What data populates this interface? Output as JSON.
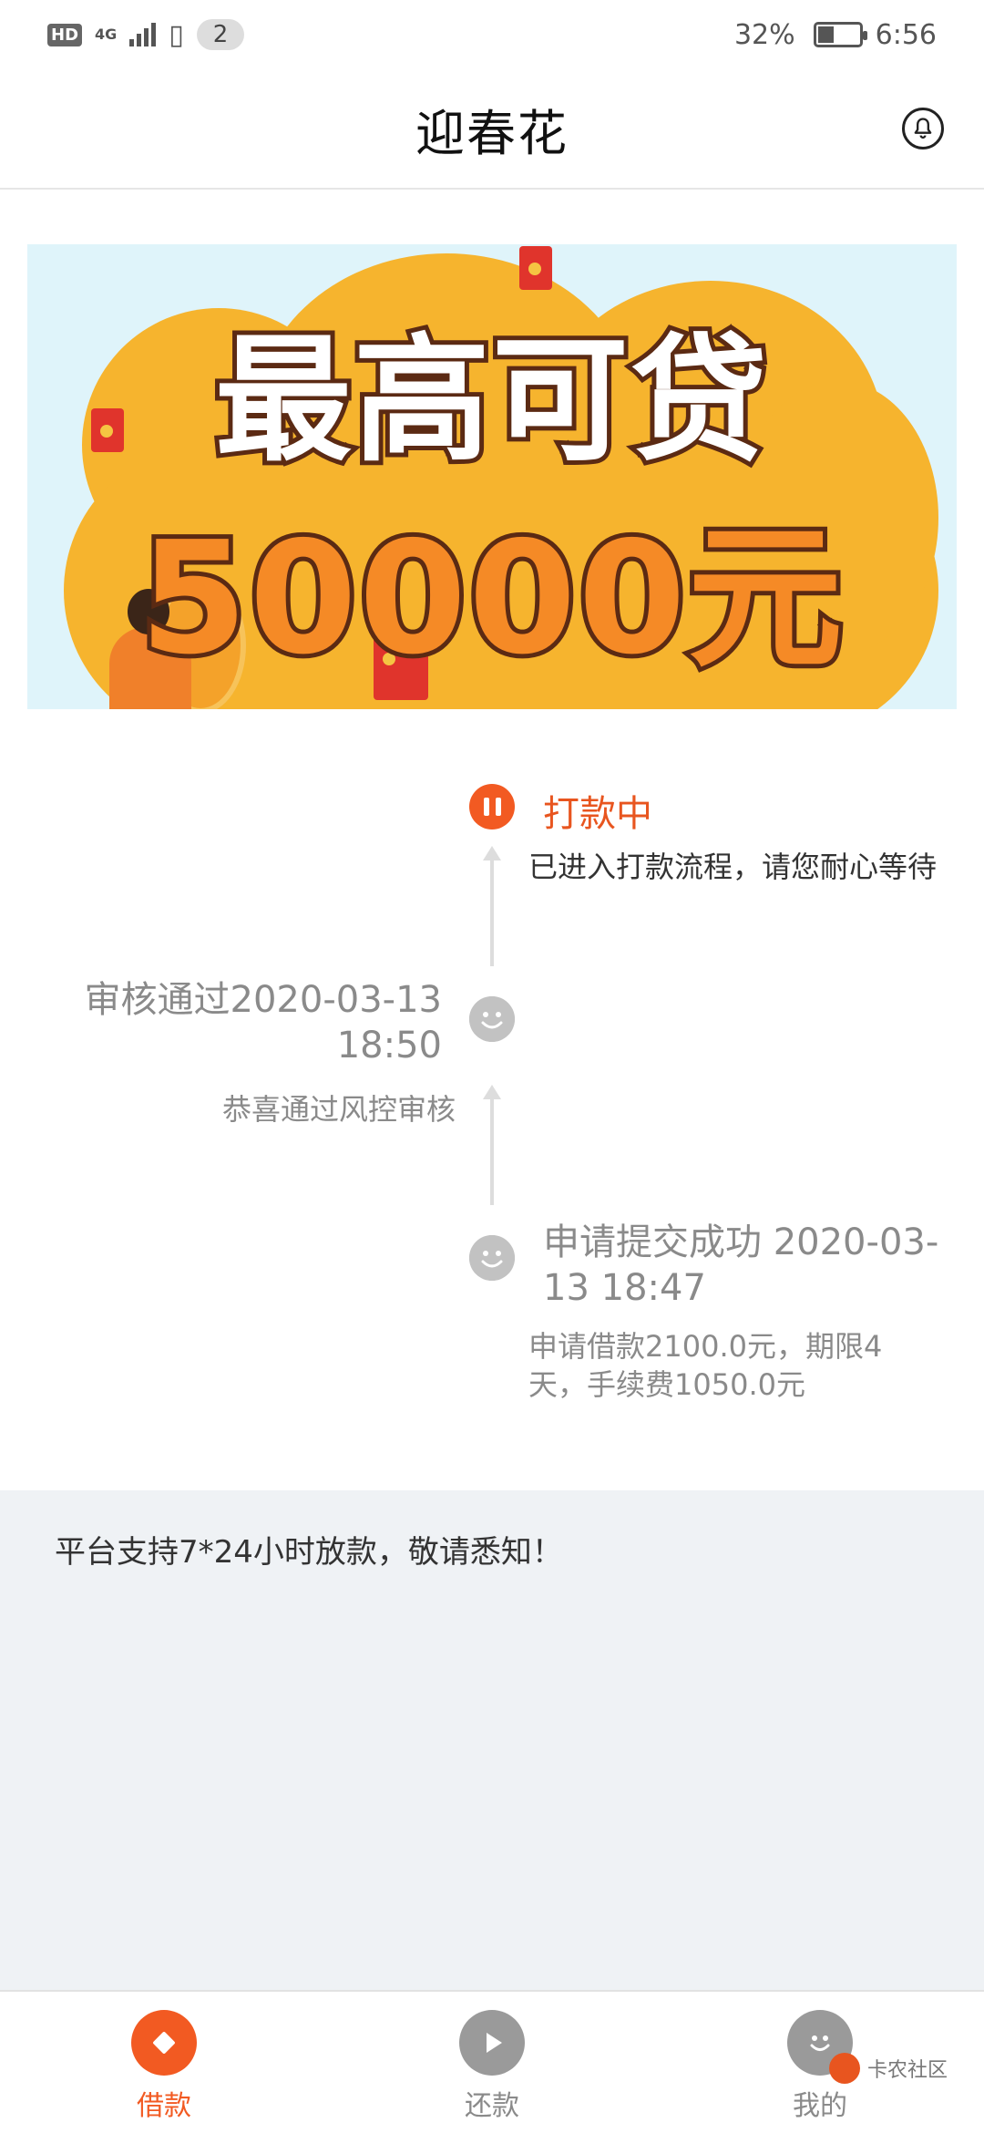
{
  "status_bar": {
    "hd": "HD",
    "network": "4G",
    "notification_count": "2",
    "battery_percent": "32%",
    "time": "6:56"
  },
  "header": {
    "title": "迎春花",
    "bell_icon": "bell-icon"
  },
  "banner": {
    "line1": "最高可贷",
    "line2": "50000元"
  },
  "timeline": {
    "step_paying": {
      "title": "打款中",
      "desc": "已进入打款流程，请您耐心等待"
    },
    "step_approved": {
      "title": "审核通过2020-03-13 18:50",
      "desc": "恭喜通过风控审核"
    },
    "step_submitted": {
      "title": "申请提交成功 2020-03-13 18:47",
      "desc": "申请借款2100.0元，期限4天，手续费1050.0元"
    }
  },
  "notice": {
    "text": "平台支持7*24小时放款，敬请悉知！"
  },
  "bottom_nav": {
    "items": [
      {
        "label": "借款",
        "icon": "diamond-icon",
        "active": true
      },
      {
        "label": "还款",
        "icon": "play-icon",
        "active": false
      },
      {
        "label": "我的",
        "icon": "smiley-icon",
        "active": false
      }
    ]
  },
  "watermark": {
    "text": "卡农社区"
  },
  "colors": {
    "accent": "#f25a22",
    "inactive": "#9a9a9a",
    "notice_bg": "#eff2f5"
  }
}
